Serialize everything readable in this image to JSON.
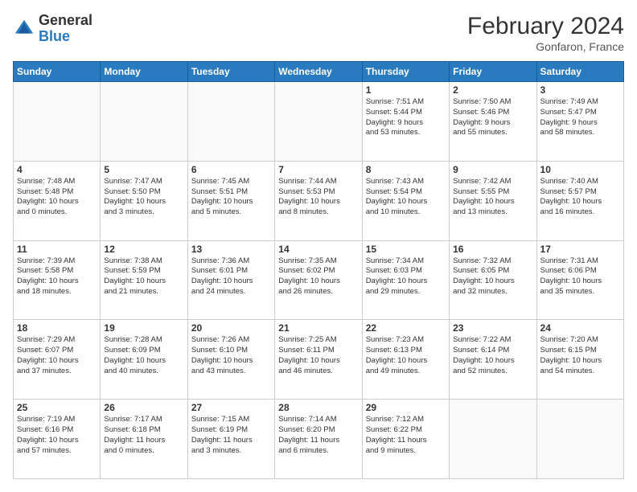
{
  "header": {
    "logo_general": "General",
    "logo_blue": "Blue",
    "month_year": "February 2024",
    "location": "Gonfaron, France"
  },
  "weekdays": [
    "Sunday",
    "Monday",
    "Tuesday",
    "Wednesday",
    "Thursday",
    "Friday",
    "Saturday"
  ],
  "weeks": [
    [
      {
        "day": "",
        "info": ""
      },
      {
        "day": "",
        "info": ""
      },
      {
        "day": "",
        "info": ""
      },
      {
        "day": "",
        "info": ""
      },
      {
        "day": "1",
        "info": "Sunrise: 7:51 AM\nSunset: 5:44 PM\nDaylight: 9 hours\nand 53 minutes."
      },
      {
        "day": "2",
        "info": "Sunrise: 7:50 AM\nSunset: 5:46 PM\nDaylight: 9 hours\nand 55 minutes."
      },
      {
        "day": "3",
        "info": "Sunrise: 7:49 AM\nSunset: 5:47 PM\nDaylight: 9 hours\nand 58 minutes."
      }
    ],
    [
      {
        "day": "4",
        "info": "Sunrise: 7:48 AM\nSunset: 5:48 PM\nDaylight: 10 hours\nand 0 minutes."
      },
      {
        "day": "5",
        "info": "Sunrise: 7:47 AM\nSunset: 5:50 PM\nDaylight: 10 hours\nand 3 minutes."
      },
      {
        "day": "6",
        "info": "Sunrise: 7:45 AM\nSunset: 5:51 PM\nDaylight: 10 hours\nand 5 minutes."
      },
      {
        "day": "7",
        "info": "Sunrise: 7:44 AM\nSunset: 5:53 PM\nDaylight: 10 hours\nand 8 minutes."
      },
      {
        "day": "8",
        "info": "Sunrise: 7:43 AM\nSunset: 5:54 PM\nDaylight: 10 hours\nand 10 minutes."
      },
      {
        "day": "9",
        "info": "Sunrise: 7:42 AM\nSunset: 5:55 PM\nDaylight: 10 hours\nand 13 minutes."
      },
      {
        "day": "10",
        "info": "Sunrise: 7:40 AM\nSunset: 5:57 PM\nDaylight: 10 hours\nand 16 minutes."
      }
    ],
    [
      {
        "day": "11",
        "info": "Sunrise: 7:39 AM\nSunset: 5:58 PM\nDaylight: 10 hours\nand 18 minutes."
      },
      {
        "day": "12",
        "info": "Sunrise: 7:38 AM\nSunset: 5:59 PM\nDaylight: 10 hours\nand 21 minutes."
      },
      {
        "day": "13",
        "info": "Sunrise: 7:36 AM\nSunset: 6:01 PM\nDaylight: 10 hours\nand 24 minutes."
      },
      {
        "day": "14",
        "info": "Sunrise: 7:35 AM\nSunset: 6:02 PM\nDaylight: 10 hours\nand 26 minutes."
      },
      {
        "day": "15",
        "info": "Sunrise: 7:34 AM\nSunset: 6:03 PM\nDaylight: 10 hours\nand 29 minutes."
      },
      {
        "day": "16",
        "info": "Sunrise: 7:32 AM\nSunset: 6:05 PM\nDaylight: 10 hours\nand 32 minutes."
      },
      {
        "day": "17",
        "info": "Sunrise: 7:31 AM\nSunset: 6:06 PM\nDaylight: 10 hours\nand 35 minutes."
      }
    ],
    [
      {
        "day": "18",
        "info": "Sunrise: 7:29 AM\nSunset: 6:07 PM\nDaylight: 10 hours\nand 37 minutes."
      },
      {
        "day": "19",
        "info": "Sunrise: 7:28 AM\nSunset: 6:09 PM\nDaylight: 10 hours\nand 40 minutes."
      },
      {
        "day": "20",
        "info": "Sunrise: 7:26 AM\nSunset: 6:10 PM\nDaylight: 10 hours\nand 43 minutes."
      },
      {
        "day": "21",
        "info": "Sunrise: 7:25 AM\nSunset: 6:11 PM\nDaylight: 10 hours\nand 46 minutes."
      },
      {
        "day": "22",
        "info": "Sunrise: 7:23 AM\nSunset: 6:13 PM\nDaylight: 10 hours\nand 49 minutes."
      },
      {
        "day": "23",
        "info": "Sunrise: 7:22 AM\nSunset: 6:14 PM\nDaylight: 10 hours\nand 52 minutes."
      },
      {
        "day": "24",
        "info": "Sunrise: 7:20 AM\nSunset: 6:15 PM\nDaylight: 10 hours\nand 54 minutes."
      }
    ],
    [
      {
        "day": "25",
        "info": "Sunrise: 7:19 AM\nSunset: 6:16 PM\nDaylight: 10 hours\nand 57 minutes."
      },
      {
        "day": "26",
        "info": "Sunrise: 7:17 AM\nSunset: 6:18 PM\nDaylight: 11 hours\nand 0 minutes."
      },
      {
        "day": "27",
        "info": "Sunrise: 7:15 AM\nSunset: 6:19 PM\nDaylight: 11 hours\nand 3 minutes."
      },
      {
        "day": "28",
        "info": "Sunrise: 7:14 AM\nSunset: 6:20 PM\nDaylight: 11 hours\nand 6 minutes."
      },
      {
        "day": "29",
        "info": "Sunrise: 7:12 AM\nSunset: 6:22 PM\nDaylight: 11 hours\nand 9 minutes."
      },
      {
        "day": "",
        "info": ""
      },
      {
        "day": "",
        "info": ""
      }
    ]
  ]
}
